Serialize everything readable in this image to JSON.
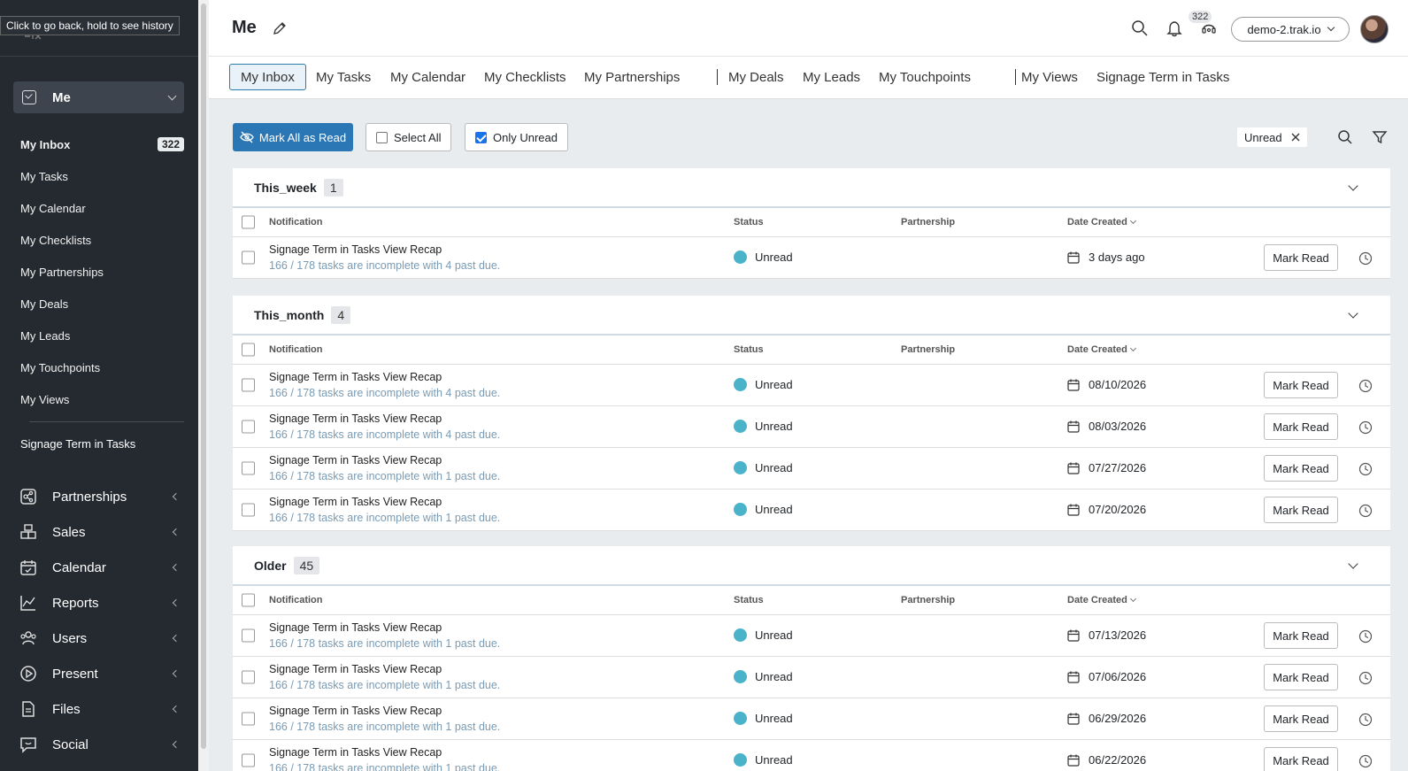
{
  "tooltip": "Click to go back, hold to see history",
  "sidebar": {
    "me_label": "Me",
    "sub_items": [
      {
        "label": "My Inbox",
        "count": "322",
        "active": true
      },
      {
        "label": "My Tasks"
      },
      {
        "label": "My Calendar"
      },
      {
        "label": "My Checklists"
      },
      {
        "label": "My Partnerships"
      },
      {
        "label": "My Deals"
      },
      {
        "label": "My Leads"
      },
      {
        "label": "My Touchpoints"
      },
      {
        "label": "My Views"
      }
    ],
    "extra_item": "Signage Term in Tasks",
    "nav": [
      {
        "label": "Partnerships",
        "icon": "partnerships-icon"
      },
      {
        "label": "Sales",
        "icon": "sales-icon"
      },
      {
        "label": "Calendar",
        "icon": "calendar-icon"
      },
      {
        "label": "Reports",
        "icon": "reports-icon"
      },
      {
        "label": "Users",
        "icon": "users-icon"
      },
      {
        "label": "Present",
        "icon": "present-icon"
      },
      {
        "label": "Files",
        "icon": "files-icon"
      },
      {
        "label": "Social",
        "icon": "social-icon"
      }
    ]
  },
  "header": {
    "title": "Me",
    "notification_count": "322",
    "org": "demo-2.trak.io"
  },
  "tabs": [
    "My Inbox",
    "My Tasks",
    "My Calendar",
    "My Checklists",
    "My Partnerships",
    "My Deals",
    "My Leads",
    "My Touchpoints",
    "My Views",
    "Signage Term in Tasks"
  ],
  "toolbar": {
    "mark_all": "Mark All as Read",
    "select_all": "Select All",
    "only_unread": "Only Unread",
    "filter_chip": "Unread"
  },
  "columns": {
    "notification": "Notification",
    "status": "Status",
    "partnership": "Partnership",
    "date_created": "Date Created"
  },
  "row_action": "Mark Read",
  "groups": [
    {
      "title": "This_week",
      "count": "1",
      "rows": [
        {
          "title": "Signage Term in Tasks View Recap",
          "sub": "166 / 178 tasks are incomplete with 4 past due.",
          "status": "Unread",
          "date": "3 days ago"
        }
      ]
    },
    {
      "title": "This_month",
      "count": "4",
      "rows": [
        {
          "title": "Signage Term in Tasks View Recap",
          "sub": "166 / 178 tasks are incomplete with 4 past due.",
          "status": "Unread",
          "date": "08/10/2026"
        },
        {
          "title": "Signage Term in Tasks View Recap",
          "sub": "166 / 178 tasks are incomplete with 4 past due.",
          "status": "Unread",
          "date": "08/03/2026"
        },
        {
          "title": "Signage Term in Tasks View Recap",
          "sub": "166 / 178 tasks are incomplete with 1 past due.",
          "status": "Unread",
          "date": "07/27/2026"
        },
        {
          "title": "Signage Term in Tasks View Recap",
          "sub": "166 / 178 tasks are incomplete with 1 past due.",
          "status": "Unread",
          "date": "07/20/2026"
        }
      ]
    },
    {
      "title": "Older",
      "count": "45",
      "rows": [
        {
          "title": "Signage Term in Tasks View Recap",
          "sub": "166 / 178 tasks are incomplete with 1 past due.",
          "status": "Unread",
          "date": "07/13/2026"
        },
        {
          "title": "Signage Term in Tasks View Recap",
          "sub": "166 / 178 tasks are incomplete with 1 past due.",
          "status": "Unread",
          "date": "07/06/2026"
        },
        {
          "title": "Signage Term in Tasks View Recap",
          "sub": "166 / 178 tasks are incomplete with 1 past due.",
          "status": "Unread",
          "date": "06/29/2026"
        },
        {
          "title": "Signage Term in Tasks View Recap",
          "sub": "166 / 178 tasks are incomplete with 1 past due.",
          "status": "Unread",
          "date": "06/22/2026"
        }
      ]
    }
  ],
  "colors": {
    "sidebar_bg": "#252a31",
    "primary": "#2b77b5",
    "unread_dot": "#4bb3c9",
    "sub_text": "#7a9bb3"
  }
}
